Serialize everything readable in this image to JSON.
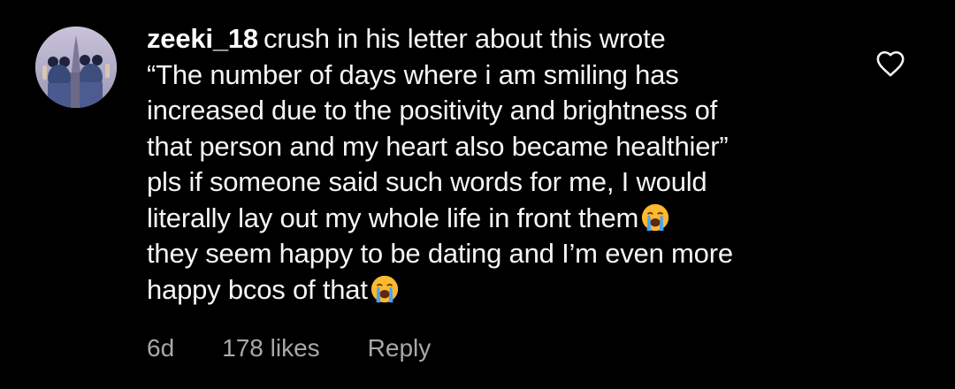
{
  "comment": {
    "username": "zeeki_18",
    "lines": [
      "crush in his letter about this wrote",
      "“The number of days where i am smiling has",
      "increased due to the positivity and brightness of",
      "that person and my heart also became healthier”",
      "pls if someone said such words for me, I would",
      "literally lay out my whole life in front them",
      "they seem happy to be dating and I’m even more",
      "happy bcos of that"
    ],
    "emoji_name": "loudly-crying-face-icon",
    "time": "6d",
    "likes": "178 likes",
    "reply_label": "Reply"
  },
  "icons": {
    "like": "heart-outline-icon",
    "avatar": "user-avatar"
  },
  "colors": {
    "background": "#000000",
    "text": "#f5f5f5",
    "meta": "#a8a8a8",
    "emoji_face": "#ffb92e",
    "emoji_tears": "#4aa3f0"
  }
}
